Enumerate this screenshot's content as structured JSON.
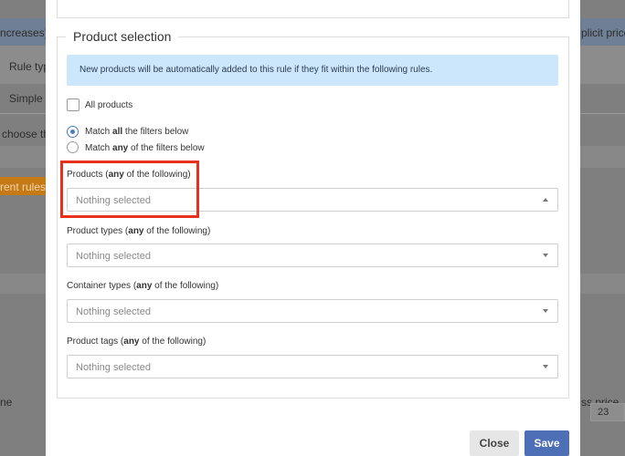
{
  "background": {
    "text_increases": "ncreases) to",
    "text_explicit": "plicit price' b",
    "col_rule_type": "Rule type",
    "row_simple": "Simple",
    "text_choose": "choose the",
    "orange_label": "rent rules c",
    "col_ne": "ne",
    "col_price": "ss price",
    "page_23": "23"
  },
  "section": {
    "legend": "Product selection",
    "info": "New products will be automatically added to this rule if they fit within the following rules.",
    "all_products": "All products",
    "match_all_pre": "Match ",
    "match_all_bold": "all",
    "match_all_post": " the filters below",
    "match_any_pre": "Match ",
    "match_any_bold": "any",
    "match_any_post": " of the filters below"
  },
  "filters": [
    {
      "label_pre": "Products (",
      "label_bold": "any",
      "label_post": " of the following)",
      "placeholder": "Nothing selected"
    },
    {
      "label_pre": "Product types (",
      "label_bold": "any",
      "label_post": " of the following)",
      "placeholder": "Nothing selected"
    },
    {
      "label_pre": "Container types (",
      "label_bold": "any",
      "label_post": " of the following)",
      "placeholder": "Nothing selected"
    },
    {
      "label_pre": "Product tags (",
      "label_bold": "any",
      "label_post": " of the following)",
      "placeholder": "Nothing selected"
    }
  ],
  "footer": {
    "close_label": "Close",
    "save_label": "Save"
  },
  "colors": {
    "accent": "#4d6fb5",
    "info_bg": "#cce6fb",
    "highlight": "#e8301c",
    "orange": "#c57a16"
  }
}
